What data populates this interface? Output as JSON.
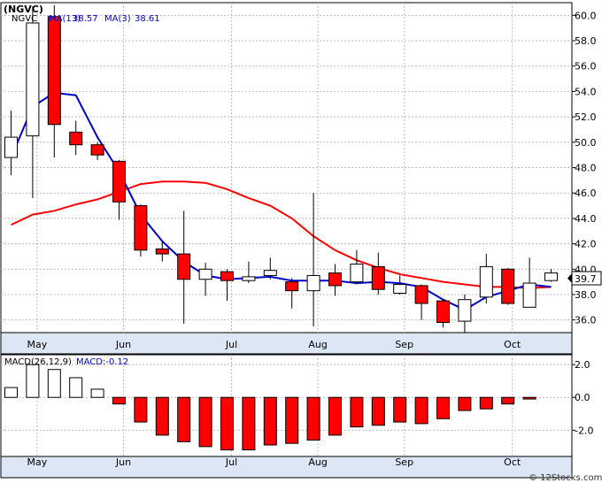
{
  "chart_data": {
    "type": "candlestick",
    "title": "(NGVC)",
    "ticker": "NGVC",
    "legend": [
      {
        "label": "MA(13)",
        "value": "38.57",
        "color": "#0000cc"
      },
      {
        "label": "MA(3)",
        "value": "38.61",
        "color": "#0000cc"
      }
    ],
    "last_price_label": "39.7",
    "x_tick_labels": [
      "May",
      "Jun",
      "Jul",
      "Aug",
      "Sep",
      "Oct"
    ],
    "x_tick_index": [
      1,
      5,
      10,
      14,
      18,
      23
    ],
    "price_axis": {
      "min": 35.0,
      "max": 61.0,
      "ticks": [
        36.0,
        38.0,
        40.0,
        42.0,
        44.0,
        46.0,
        48.0,
        50.0,
        52.0,
        54.0,
        56.0,
        58.0,
        60.0
      ],
      "tick_labels": [
        "36.0",
        "38.0",
        "40.0",
        "42.0",
        "44.0",
        "46.0",
        "48.0",
        "50.0",
        "52.0",
        "54.0",
        "56.0",
        "58.0",
        "60.0"
      ]
    },
    "candles": [
      {
        "o": 48.8,
        "h": 52.5,
        "l": 47.4,
        "c": 50.4
      },
      {
        "o": 50.5,
        "h": 60.7,
        "l": 45.6,
        "c": 59.4
      },
      {
        "o": 59.9,
        "h": 60.8,
        "l": 48.8,
        "c": 51.4
      },
      {
        "o": 50.8,
        "h": 51.7,
        "l": 49.0,
        "c": 49.8
      },
      {
        "o": 49.8,
        "h": 50.0,
        "l": 48.6,
        "c": 49.0
      },
      {
        "o": 48.5,
        "h": 48.6,
        "l": 43.9,
        "c": 45.3
      },
      {
        "o": 45.0,
        "h": 45.1,
        "l": 41.0,
        "c": 41.5
      },
      {
        "o": 41.6,
        "h": 42.2,
        "l": 40.6,
        "c": 41.2
      },
      {
        "o": 41.2,
        "h": 44.6,
        "l": 35.7,
        "c": 39.2
      },
      {
        "o": 39.2,
        "h": 40.5,
        "l": 37.9,
        "c": 40.0
      },
      {
        "o": 39.8,
        "h": 40.0,
        "l": 37.5,
        "c": 39.1
      },
      {
        "o": 39.1,
        "h": 40.6,
        "l": 38.9,
        "c": 39.4
      },
      {
        "o": 39.5,
        "h": 40.9,
        "l": 39.2,
        "c": 39.9
      },
      {
        "o": 39.0,
        "h": 39.3,
        "l": 36.9,
        "c": 38.3
      },
      {
        "o": 38.3,
        "h": 46.0,
        "l": 35.5,
        "c": 39.5
      },
      {
        "o": 39.7,
        "h": 40.4,
        "l": 37.9,
        "c": 38.7
      },
      {
        "o": 39.0,
        "h": 41.5,
        "l": 38.8,
        "c": 40.4
      },
      {
        "o": 40.2,
        "h": 41.3,
        "l": 38.0,
        "c": 38.4
      },
      {
        "o": 38.1,
        "h": 39.5,
        "l": 38.0,
        "c": 38.8
      },
      {
        "o": 38.7,
        "h": 38.8,
        "l": 36.0,
        "c": 37.3
      },
      {
        "o": 37.5,
        "h": 37.6,
        "l": 35.4,
        "c": 35.8
      },
      {
        "o": 35.9,
        "h": 38.0,
        "l": 35.0,
        "c": 37.6
      },
      {
        "o": 37.8,
        "h": 41.2,
        "l": 37.3,
        "c": 40.2
      },
      {
        "o": 40.0,
        "h": 40.1,
        "l": 37.2,
        "c": 37.3
      },
      {
        "o": 37.0,
        "h": 40.9,
        "l": 37.0,
        "c": 38.9
      },
      {
        "o": 39.1,
        "h": 40.0,
        "l": 39.0,
        "c": 39.7
      }
    ],
    "ma13": [
      43.5,
      44.3,
      44.6,
      45.1,
      45.5,
      46.1,
      46.7,
      46.9,
      46.9,
      46.8,
      46.3,
      45.6,
      45.0,
      44.0,
      42.6,
      41.5,
      40.7,
      40.1,
      39.6,
      39.3,
      39.0,
      38.8,
      38.6,
      38.6,
      38.5,
      38.6
    ],
    "ma3": [
      48.8,
      52.8,
      53.9,
      53.7,
      50.4,
      47.7,
      44.3,
      42.2,
      40.6,
      39.5,
      39.2,
      39.3,
      39.4,
      39.1,
      39.1,
      39.1,
      38.9,
      39.0,
      38.9,
      38.6,
      37.6,
      36.8,
      37.8,
      38.3,
      38.8,
      38.6
    ],
    "macd": {
      "label": "MACD(26,12,9)",
      "value_label": "MACD:-0.12",
      "axis": {
        "min": -3.6,
        "max": 2.6,
        "ticks": [
          -2.0,
          0.0,
          2.0
        ],
        "tick_labels": [
          "-2.0",
          "0.0",
          "2.0"
        ]
      },
      "histogram": [
        0.6,
        2.0,
        1.7,
        1.2,
        0.5,
        -0.4,
        -1.5,
        -2.3,
        -2.7,
        -3.0,
        -3.2,
        -3.2,
        -2.9,
        -2.8,
        -2.6,
        -2.3,
        -1.8,
        -1.7,
        -1.5,
        -1.6,
        -1.3,
        -0.8,
        -0.7,
        -0.4,
        -0.1
      ]
    },
    "watermark": "© 12Stocks.com",
    "grid": true
  },
  "colors": {
    "up": "#ffffff",
    "down": "#ff0000",
    "ma13_line": "#ff0000",
    "ma3_line": "#0000cc",
    "grid": "#bbbbbb",
    "macd_pos": "#ffffff",
    "macd_neg": "#ff0000"
  }
}
